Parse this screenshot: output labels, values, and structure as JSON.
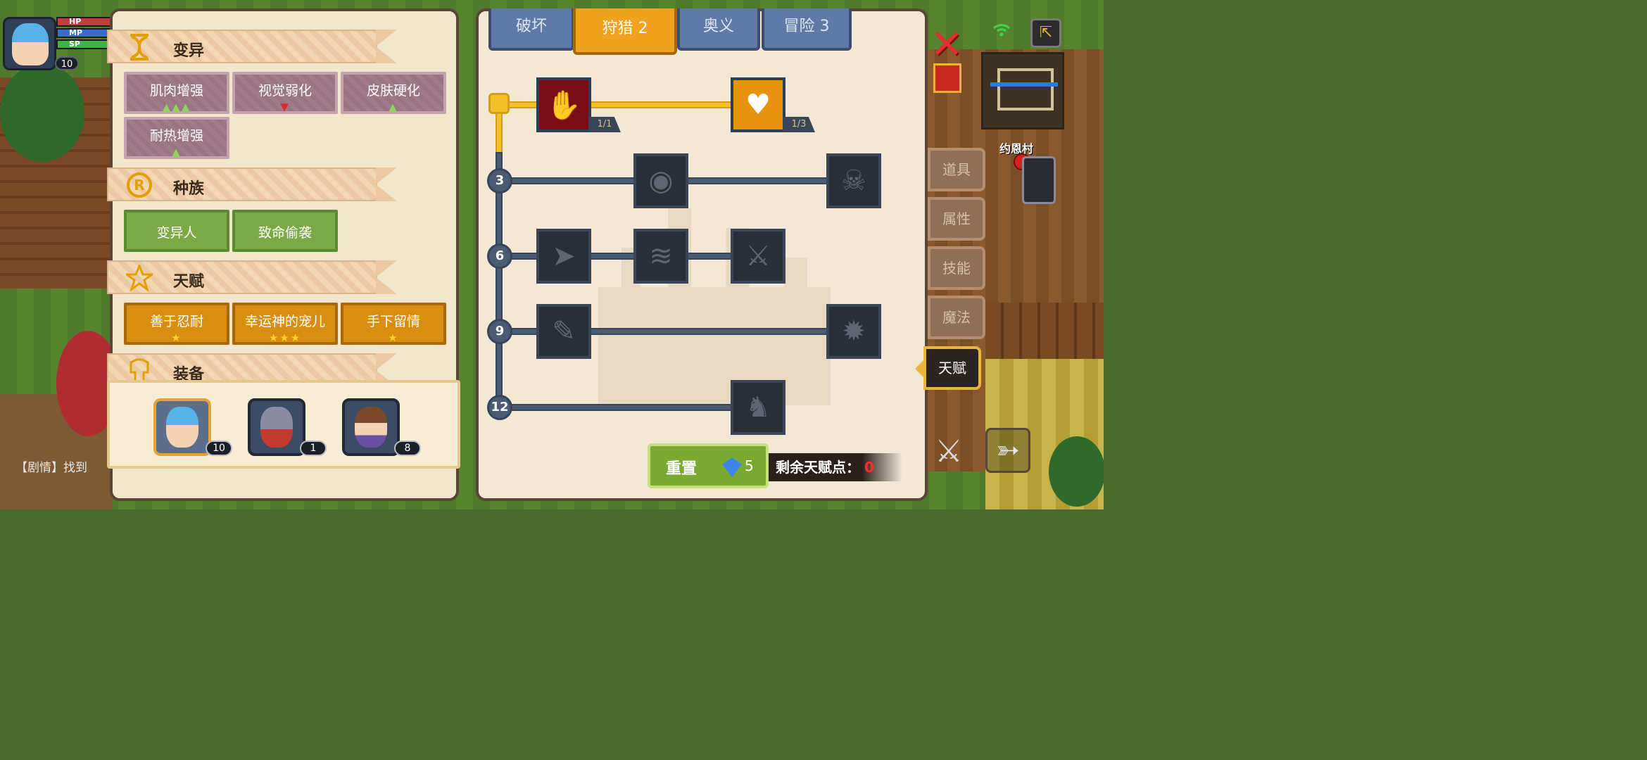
{
  "hud": {
    "hp_label": "HP",
    "mp_label": "MP",
    "sp_label": "SP",
    "level": "10"
  },
  "sections": {
    "mutation": {
      "title": "变异",
      "icon": "dna-icon",
      "items": [
        {
          "label": "肌肉增强",
          "marks": "▲▲▲",
          "type": "up"
        },
        {
          "label": "视觉弱化",
          "marks": "▼",
          "type": "down"
        },
        {
          "label": "皮肤硬化",
          "marks": "▲",
          "type": "up"
        },
        {
          "label": "耐热增强",
          "marks": "▲",
          "type": "up"
        }
      ]
    },
    "race": {
      "title": "种族",
      "icon": "race-emblem-icon",
      "icon_text": "R",
      "items": [
        {
          "label": "变异人"
        },
        {
          "label": "致命偷袭"
        }
      ]
    },
    "talent": {
      "title": "天赋",
      "icon": "star-icon",
      "items": [
        {
          "label": "善于忍耐",
          "stars": "★"
        },
        {
          "label": "幸运神的宠儿",
          "stars": "★★★"
        },
        {
          "label": "手下留情",
          "stars": "★"
        }
      ]
    },
    "equipment": {
      "title": "装备",
      "icon": "armor-icon"
    }
  },
  "characters": [
    {
      "name": "blue-hair-hero",
      "level": "10",
      "active": true
    },
    {
      "name": "armored-knight",
      "level": "1",
      "active": false
    },
    {
      "name": "brown-hair-mage",
      "level": "8",
      "active": false
    }
  ],
  "story_text": "【剧情】找到",
  "tabs": [
    {
      "label": "破坏",
      "active": false
    },
    {
      "label": "狩猎 2",
      "active": true
    },
    {
      "label": "奥义",
      "active": false
    },
    {
      "label": "冒险 3",
      "active": false
    }
  ],
  "tree": {
    "tiers": [
      "3",
      "6",
      "9",
      "12"
    ],
    "skills": [
      {
        "icon": "slash-hand-icon",
        "count": "1/1",
        "state": "red"
      },
      {
        "icon": "strongman-icon",
        "count": "1/3",
        "state": "orange"
      },
      {
        "icon": "eye-icon"
      },
      {
        "icon": "skull-shield-icon"
      },
      {
        "icon": "dash-icon"
      },
      {
        "icon": "wing-icon"
      },
      {
        "icon": "crossed-swords-icon"
      },
      {
        "icon": "syringe-icon"
      },
      {
        "icon": "skull-gear-icon"
      },
      {
        "icon": "horse-head-icon"
      }
    ]
  },
  "reset": {
    "label": "重置",
    "cost": "5",
    "gem_icon": "diamond-icon"
  },
  "remaining": {
    "label": "剩余天赋点：",
    "value": "0"
  },
  "side_menu": [
    {
      "label": "道具",
      "active": false
    },
    {
      "label": "属性",
      "active": false
    },
    {
      "label": "技能",
      "active": false
    },
    {
      "label": "魔法",
      "active": false
    },
    {
      "label": "天赋",
      "active": true
    }
  ],
  "map": {
    "village": "约恩村"
  },
  "colors": {
    "accent_orange": "#f0a21e",
    "tab_blue": "#5f79a8",
    "remaining_red": "#ff2b2b",
    "race_green": "#7aa946",
    "mutation_mauve": "#a07c8a"
  }
}
